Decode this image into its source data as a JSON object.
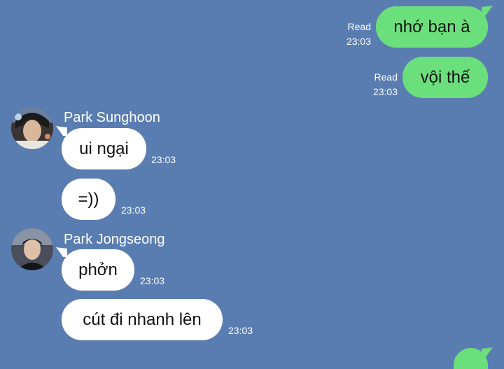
{
  "colors": {
    "background": "#5a7db1",
    "outgoing_bubble": "#6bdf7c",
    "incoming_bubble": "#ffffff"
  },
  "outgoing": [
    {
      "text": "nhớ bạn à",
      "status": "Read",
      "time": "23:03"
    },
    {
      "text": "vội thế",
      "status": "Read",
      "time": "23:03"
    }
  ],
  "senders": [
    {
      "name": "Park Sunghoon",
      "avatar_icon": "profile-photo",
      "messages": [
        {
          "text": "ui ngại",
          "time": "23:03"
        },
        {
          "text": "=))",
          "time": "23:03"
        }
      ]
    },
    {
      "name": "Park Jongseong",
      "avatar_icon": "profile-photo",
      "messages": [
        {
          "text": "phởn",
          "time": "23:03"
        },
        {
          "text": "cút đi nhanh lên",
          "time": "23:03"
        }
      ]
    }
  ]
}
